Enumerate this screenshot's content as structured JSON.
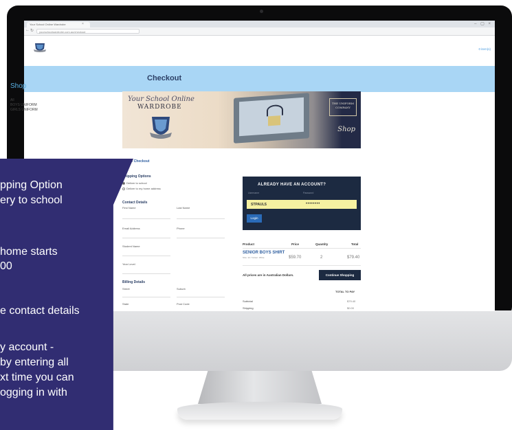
{
  "browser": {
    "tab_title": "Your School Online Wardrobe",
    "tab_close": "×",
    "window_controls": "– ▢ ×",
    "url": "yourschoolwardrobe.com.au/checkout"
  },
  "site": {
    "cart_link": "0 item(s)",
    "page_title": "Checkout"
  },
  "sidebar": {
    "title": "Shop",
    "links": [
      "All",
      "BOYS UNIFORM",
      "GIRLS UNIFORM"
    ]
  },
  "hero": {
    "script_text": "Your School Online",
    "brand": "WARDROBE",
    "company_badge": "THE UNIFORM COMPANY",
    "shop_script": "Shop"
  },
  "breadcrumb": "Shop / Checkout",
  "shipping": {
    "heading": "Shipping Options",
    "options": [
      {
        "label": "Deliver to school",
        "selected": true
      },
      {
        "label": "Deliver to my home address",
        "selected": false
      }
    ]
  },
  "contact": {
    "heading": "Contact Details",
    "fields": [
      "First Name",
      "Last Name",
      "Email Address",
      "Phone",
      "Student Name",
      "Year Level"
    ]
  },
  "billing": {
    "heading": "Billing Details",
    "fields": [
      "Street",
      "Suburb",
      "State",
      "Post Code"
    ]
  },
  "login": {
    "title": "ALREADY HAVE AN ACCOUNT?",
    "username_label": "Username",
    "password_label": "Password",
    "username_value": "STPAULS",
    "password_value": "••••••••",
    "button": "Login"
  },
  "cart": {
    "headers": [
      "Product",
      "Price",
      "Quantity",
      "Total"
    ],
    "items": [
      {
        "name": "SENIOR BOYS SHIRT",
        "sub": "Size: 12 / Colour: White",
        "price": "$59.70",
        "qty": "2",
        "total": "$79.40"
      }
    ],
    "note": "All prices are in Australian Dollars.",
    "continue_button": "Continue Shopping",
    "total_heading": "TOTAL TO PAY",
    "summary": [
      {
        "label": "Subtotal",
        "value": "$79.40"
      },
      {
        "label": "Shipping",
        "value": "$0.00"
      }
    ]
  },
  "overlay": {
    "lines": [
      "pping Option",
      "ery to school",
      "",
      " home starts",
      "00",
      "",
      "e contact details",
      "",
      "y account -",
      "by entering all",
      "xt time you can",
      "ogging in with"
    ]
  }
}
